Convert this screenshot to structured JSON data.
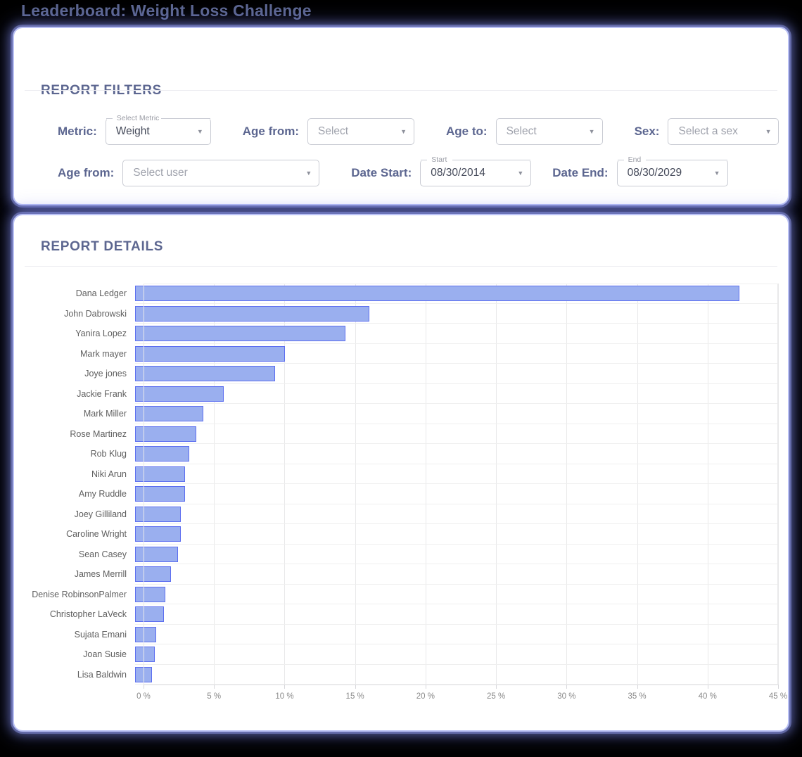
{
  "page": {
    "title": "Leaderboard: Weight Loss Challenge"
  },
  "filters": {
    "heading": "REPORT FILTERS",
    "metric": {
      "label": "Metric:",
      "float_label": "Select Metric",
      "value": "Weight"
    },
    "age_from_top": {
      "label": "Age from:",
      "value": "Select"
    },
    "age_to": {
      "label": "Age to:",
      "value": "Select"
    },
    "sex": {
      "label": "Sex:",
      "value": "Select a sex"
    },
    "user": {
      "label": "Age from:",
      "value": "Select user"
    },
    "date_start": {
      "label": "Date Start:",
      "float_label": "Start",
      "value": "08/30/2014"
    },
    "date_end": {
      "label": "Date End:",
      "float_label": "End",
      "value": "08/30/2029"
    }
  },
  "details": {
    "heading": "REPORT DETAILS"
  },
  "chart_data": {
    "type": "bar",
    "orientation": "horizontal",
    "title": "",
    "xlabel": "",
    "ylabel": "",
    "xlim": [
      0,
      45
    ],
    "grid": true,
    "legend": false,
    "tick_labels": [
      "0 %",
      "5 %",
      "10 %",
      "15 %",
      "20 %",
      "25 %",
      "30 %",
      "35 %",
      "40 %",
      "45 %"
    ],
    "ticks": [
      0,
      5,
      10,
      15,
      20,
      25,
      30,
      35,
      40,
      45
    ],
    "bar_fill": "#9aafef",
    "bar_border": "#5c6ef0",
    "categories": [
      "Dana Ledger",
      "John Dabrowski",
      "Yanira Lopez",
      "Mark mayer",
      "Joye jones",
      "Jackie Frank",
      "Mark Miller",
      "Rose Martinez",
      "Rob Klug",
      "Niki Arun",
      "Amy Ruddle",
      "Joey Gilliland",
      "Caroline Wright",
      "Sean Casey",
      "James Merrill",
      "Denise RobinsonPalmer",
      "Christopher LaVeck",
      "Sujata Emani",
      "Joan Susie",
      "Lisa Baldwin"
    ],
    "values": [
      42.3,
      16.4,
      14.7,
      10.5,
      9.8,
      6.2,
      4.8,
      4.3,
      3.8,
      3.5,
      3.5,
      3.2,
      3.2,
      3.0,
      2.5,
      2.1,
      2.0,
      1.5,
      1.4,
      1.2
    ]
  }
}
